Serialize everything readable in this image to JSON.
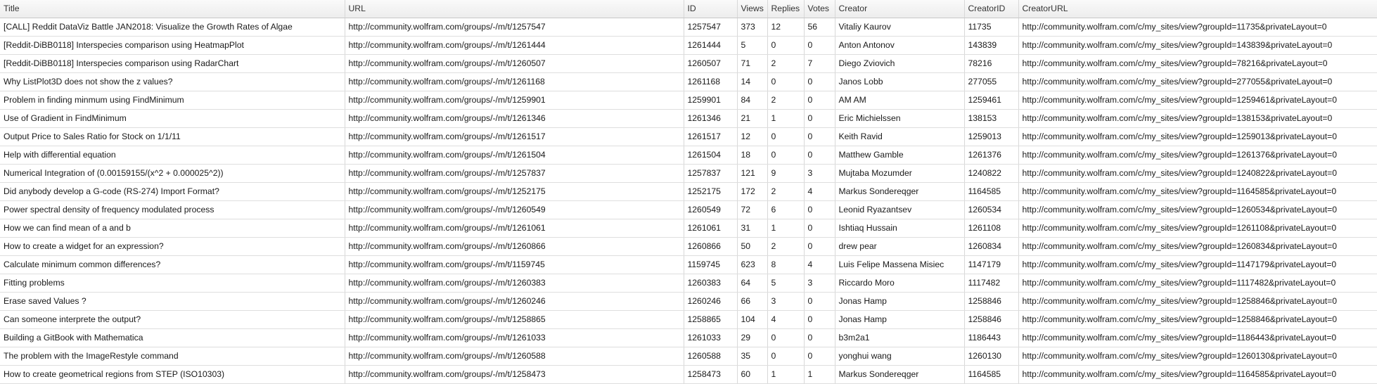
{
  "table": {
    "columns": [
      "Title",
      "URL",
      "ID",
      "Views",
      "Replies",
      "Votes",
      "Creator",
      "CreatorID",
      "CreatorURL"
    ],
    "rows": [
      [
        "[CALL] Reddit DataViz Battle JAN2018: Visualize the Growth Rates of Algae",
        "http://community.wolfram.com/groups/-/m/t/1257547",
        "1257547",
        "373",
        "12",
        "56",
        "Vitaliy Kaurov",
        "11735",
        "http://community.wolfram.com/c/my_sites/view?groupId=11735&privateLayout=0"
      ],
      [
        "[Reddit-DiBB0118] Interspecies comparison using HeatmapPlot",
        "http://community.wolfram.com/groups/-/m/t/1261444",
        "1261444",
        "5",
        "0",
        "0",
        "Anton Antonov",
        "143839",
        "http://community.wolfram.com/c/my_sites/view?groupId=143839&privateLayout=0"
      ],
      [
        "[Reddit-DiBB0118] Interspecies comparison using RadarChart",
        "http://community.wolfram.com/groups/-/m/t/1260507",
        "1260507",
        "71",
        "2",
        "7",
        "Diego Zviovich",
        "78216",
        "http://community.wolfram.com/c/my_sites/view?groupId=78216&privateLayout=0"
      ],
      [
        "Why ListPlot3D does not show the z values?",
        "http://community.wolfram.com/groups/-/m/t/1261168",
        "1261168",
        "14",
        "0",
        "0",
        "Janos Lobb",
        "277055",
        "http://community.wolfram.com/c/my_sites/view?groupId=277055&privateLayout=0"
      ],
      [
        "Problem in finding minmum using FindMinimum",
        "http://community.wolfram.com/groups/-/m/t/1259901",
        "1259901",
        "84",
        "2",
        "0",
        "AM AM",
        "1259461",
        "http://community.wolfram.com/c/my_sites/view?groupId=1259461&privateLayout=0"
      ],
      [
        "Use of Gradient in FindMinimum",
        "http://community.wolfram.com/groups/-/m/t/1261346",
        "1261346",
        "21",
        "1",
        "0",
        "Eric Michielssen",
        "138153",
        "http://community.wolfram.com/c/my_sites/view?groupId=138153&privateLayout=0"
      ],
      [
        "Output Price to Sales Ratio for Stock on 1/1/11",
        "http://community.wolfram.com/groups/-/m/t/1261517",
        "1261517",
        "12",
        "0",
        "0",
        "Keith Ravid",
        "1259013",
        "http://community.wolfram.com/c/my_sites/view?groupId=1259013&privateLayout=0"
      ],
      [
        "Help with differential equation",
        "http://community.wolfram.com/groups/-/m/t/1261504",
        "1261504",
        "18",
        "0",
        "0",
        "Matthew Gamble",
        "1261376",
        "http://community.wolfram.com/c/my_sites/view?groupId=1261376&privateLayout=0"
      ],
      [
        "Numerical Integration of (0.00159155/(x^2 + 0.000025^2))",
        "http://community.wolfram.com/groups/-/m/t/1257837",
        "1257837",
        "121",
        "9",
        "3",
        "Mujtaba Mozumder",
        "1240822",
        "http://community.wolfram.com/c/my_sites/view?groupId=1240822&privateLayout=0"
      ],
      [
        "Did anybody develop a G-code (RS-274) Import Format?",
        "http://community.wolfram.com/groups/-/m/t/1252175",
        "1252175",
        "172",
        "2",
        "4",
        "Markus Sondereqger",
        "1164585",
        "http://community.wolfram.com/c/my_sites/view?groupId=1164585&privateLayout=0"
      ],
      [
        "Power spectral density of frequency modulated process",
        "http://community.wolfram.com/groups/-/m/t/1260549",
        "1260549",
        "72",
        "6",
        "0",
        "Leonid Ryazantsev",
        "1260534",
        "http://community.wolfram.com/c/my_sites/view?groupId=1260534&privateLayout=0"
      ],
      [
        "How we can find mean of a and b",
        "http://community.wolfram.com/groups/-/m/t/1261061",
        "1261061",
        "31",
        "1",
        "0",
        "Ishtiaq Hussain",
        "1261108",
        "http://community.wolfram.com/c/my_sites/view?groupId=1261108&privateLayout=0"
      ],
      [
        "How to create a widget for an expression?",
        "http://community.wolfram.com/groups/-/m/t/1260866",
        "1260866",
        "50",
        "2",
        "0",
        "drew pear",
        "1260834",
        "http://community.wolfram.com/c/my_sites/view?groupId=1260834&privateLayout=0"
      ],
      [
        "Calculate minimum common differences?",
        "http://community.wolfram.com/groups/-/m/t/1159745",
        "1159745",
        "623",
        "8",
        "4",
        "Luis Felipe Massena Misiec",
        "1147179",
        "http://community.wolfram.com/c/my_sites/view?groupId=1147179&privateLayout=0"
      ],
      [
        "Fitting problems",
        "http://community.wolfram.com/groups/-/m/t/1260383",
        "1260383",
        "64",
        "5",
        "3",
        "Riccardo Moro",
        "1117482",
        "http://community.wolfram.com/c/my_sites/view?groupId=1117482&privateLayout=0"
      ],
      [
        "Erase saved Values ?",
        "http://community.wolfram.com/groups/-/m/t/1260246",
        "1260246",
        "66",
        "3",
        "0",
        "Jonas Hamp",
        "1258846",
        "http://community.wolfram.com/c/my_sites/view?groupId=1258846&privateLayout=0"
      ],
      [
        "Can someone interprete the output?",
        "http://community.wolfram.com/groups/-/m/t/1258865",
        "1258865",
        "104",
        "4",
        "0",
        "Jonas Hamp",
        "1258846",
        "http://community.wolfram.com/c/my_sites/view?groupId=1258846&privateLayout=0"
      ],
      [
        "Building a GitBook with Mathematica",
        "http://community.wolfram.com/groups/-/m/t/1261033",
        "1261033",
        "29",
        "0",
        "0",
        "b3m2a1",
        "1186443",
        "http://community.wolfram.com/c/my_sites/view?groupId=1186443&privateLayout=0"
      ],
      [
        "The problem with the ImageRestyle command",
        "http://community.wolfram.com/groups/-/m/t/1260588",
        "1260588",
        "35",
        "0",
        "0",
        "yonghui  wang",
        "1260130",
        "http://community.wolfram.com/c/my_sites/view?groupId=1260130&privateLayout=0"
      ],
      [
        "How to create geometrical regions from STEP (ISO10303)",
        "http://community.wolfram.com/groups/-/m/t/1258473",
        "1258473",
        "60",
        "1",
        "1",
        "Markus Sondereqger",
        "1164585",
        "http://community.wolfram.com/c/my_sites/view?groupId=1164585&privateLayout=0"
      ]
    ]
  }
}
